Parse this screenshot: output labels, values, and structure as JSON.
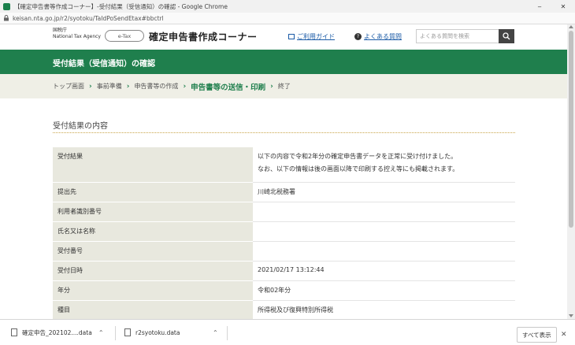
{
  "window": {
    "title": "【確定申告書等作成コーナー】-受付結果（受信通知）の確認 - Google Chrome",
    "minimize": "‒",
    "maximize": "□",
    "close": "✕"
  },
  "address_bar": {
    "url": "keisan.nta.go.jp/r2/syotoku/TaIdPoSendEtax#bbctrl"
  },
  "header": {
    "org_line1": "国税庁",
    "org_line2": "National Tax Agency",
    "badge": "e-Tax",
    "site_title": "確定申告書作成コーナー",
    "guide_link": "ご利用ガイド",
    "faq_link": "よくある質問",
    "search_placeholder": "よくある質問を検索"
  },
  "banner": {
    "title": "受付結果（受信通知）の確認"
  },
  "breadcrumb": {
    "items": [
      "トップ画面",
      "事前準備",
      "申告書等の作成",
      "申告書等の送信・印刷",
      "終了"
    ],
    "active_index": 3
  },
  "section": {
    "title": "受付結果の内容"
  },
  "result_table": {
    "rows": [
      {
        "label": "受付結果",
        "value_line1": "以下の内容で令和2年分の確定申告書データを正常に受け付けました。",
        "value_line2": "なお、以下の情報は後の画面以降で印刷する控え等にも掲載されます。"
      },
      {
        "label": "提出先",
        "value_line1": "川崎北税務署",
        "value_line2": ""
      },
      {
        "label": "利用者識別番号",
        "value_line1": "",
        "value_line2": ""
      },
      {
        "label": "氏名又は名称",
        "value_line1": "",
        "value_line2": ""
      },
      {
        "label": "受付番号",
        "value_line1": "",
        "value_line2": ""
      },
      {
        "label": "受付日時",
        "value_line1": "2021/02/17 13:12:44",
        "value_line2": ""
      },
      {
        "label": "年分",
        "value_line1": "令和02年分",
        "value_line2": ""
      },
      {
        "label": "種目",
        "value_line1": "所得税及び復興特別所得税",
        "value_line2": ""
      }
    ]
  },
  "downloads": {
    "items": [
      {
        "name": "確定申告_202102....data"
      },
      {
        "name": "r2syotoku.data"
      }
    ],
    "show_all": "すべて表示",
    "close": "✕"
  }
}
